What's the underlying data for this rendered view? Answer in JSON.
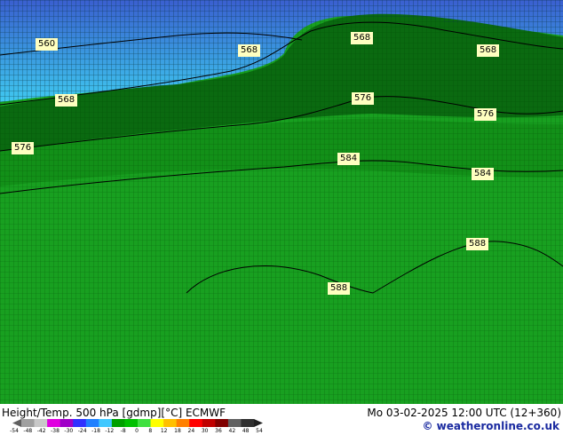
{
  "map": {
    "contour_labels": [
      {
        "text": "560"
      },
      {
        "text": "568"
      },
      {
        "text": "568"
      },
      {
        "text": "568"
      },
      {
        "text": "568"
      },
      {
        "text": "576"
      },
      {
        "text": "576"
      },
      {
        "text": "576"
      },
      {
        "text": "584"
      },
      {
        "text": "584"
      },
      {
        "text": "588"
      },
      {
        "text": "588"
      }
    ],
    "colors": {
      "cold": "#3a5fd0",
      "cyan": "#40c8f0",
      "dark_green": "#0a6a10",
      "green": "#18a020",
      "bright_green": "#22b82a"
    }
  },
  "footer": {
    "title_left": "Height/Temp. 500 hPa [gdmp][°C] ECMWF",
    "title_right": "Mo 03-02-2025 12:00 UTC (12+360)",
    "credit": "© weatheronline.co.uk"
  },
  "colorbar": {
    "ticks": [
      "-54",
      "-48",
      "-42",
      "-38",
      "-30",
      "-24",
      "-18",
      "-12",
      "-8",
      "0",
      "8",
      "12",
      "18",
      "24",
      "30",
      "36",
      "42",
      "48",
      "54"
    ],
    "colors": [
      "#a0a0a0",
      "#c8c8c8",
      "#e000e0",
      "#a000c8",
      "#3030ff",
      "#2080ff",
      "#40c8ff",
      "#00a000",
      "#00c000",
      "#40e040",
      "#ffff00",
      "#ffc000",
      "#ff8000",
      "#ff0000",
      "#c00000",
      "#800000",
      "#606060",
      "#303030"
    ]
  }
}
